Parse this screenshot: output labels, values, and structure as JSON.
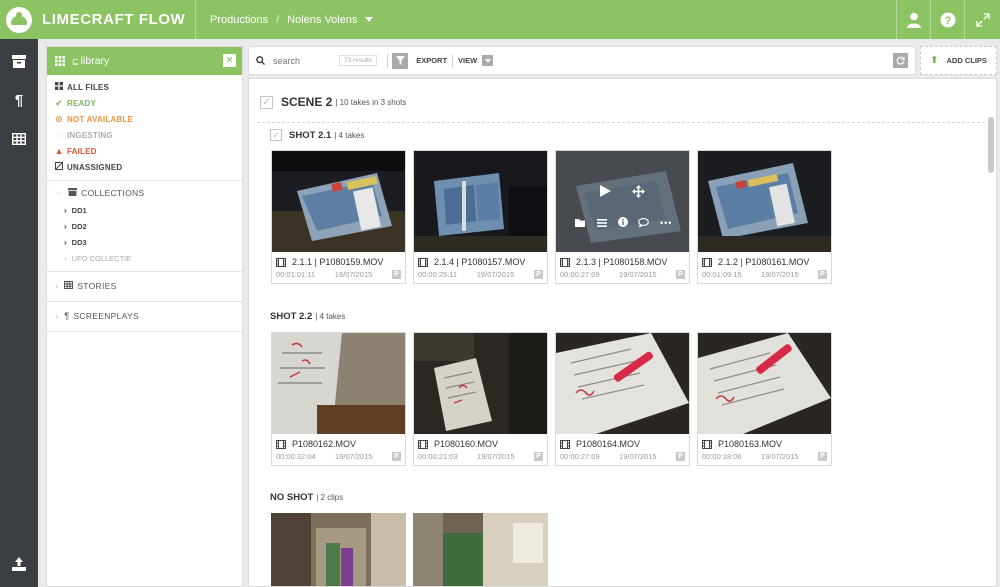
{
  "app": {
    "name": "LIMECRAFT FLOW"
  },
  "breadcrumb": {
    "section": "Productions",
    "separator": "/",
    "project": "Nolens Volens"
  },
  "library": {
    "title": "library",
    "close": "×",
    "filters": [
      {
        "label": "ALL FILES",
        "icon": "all-files-icon",
        "color": "dark"
      },
      {
        "label": "READY",
        "icon": "check-icon",
        "color": "green"
      },
      {
        "label": "NOT AVAILABLE",
        "icon": "block-icon",
        "color": "orange"
      },
      {
        "label": "INGESTING",
        "icon": "spinner-icon",
        "color": "grey"
      },
      {
        "label": "FAILED",
        "icon": "warning-icon",
        "color": "red"
      },
      {
        "label": "UNASSIGNED",
        "icon": "unassigned-icon",
        "color": "dark"
      }
    ],
    "collections": {
      "label": "COLLECTIONS",
      "items": [
        "DD1",
        "DD2",
        "DD3",
        "UFO COLLECTIE"
      ]
    },
    "stories": {
      "label": "STORIES"
    },
    "screenplays": {
      "label": "SCREENPLAYS"
    }
  },
  "toolbar": {
    "search_placeholder": "search",
    "results": "73 results",
    "export_label": "EXPORT",
    "view_label": "VIEW",
    "add_clips_label": "ADD CLIPS"
  },
  "scene": {
    "title": "SCENE 2",
    "meta": "| 10 takes in 3 shots"
  },
  "shots": [
    {
      "title": "SHOT 2.1",
      "meta": "| 4 takes",
      "clips": [
        {
          "name": "2.1.1 | P1080159.MOV",
          "duration": "00:01:01:11",
          "date": "19/07/2015"
        },
        {
          "name": "2.1.4 | P1080157.MOV",
          "duration": "00:00:25:11",
          "date": "19/07/2015"
        },
        {
          "name": "2.1.3 | P1080158.MOV",
          "duration": "00:00:27:09",
          "date": "19/07/2015"
        },
        {
          "name": "2.1.2 | P1080161.MOV",
          "duration": "00:01:09:15",
          "date": "19/07/2015"
        }
      ]
    },
    {
      "title": "SHOT 2.2",
      "meta": "| 4 takes",
      "clips": [
        {
          "name": "P1080162.MOV",
          "duration": "00:00:32:04",
          "date": "19/07/2015"
        },
        {
          "name": "P1080160.MOV",
          "duration": "00:00:21:03",
          "date": "19/07/2015"
        },
        {
          "name": "P1080164.MOV",
          "duration": "00:00:27:09",
          "date": "19/07/2015"
        },
        {
          "name": "P1080163.MOV",
          "duration": "00:00:18:06",
          "date": "19/07/2015"
        }
      ]
    },
    {
      "title": "NO SHOT",
      "meta": "| 2 clips",
      "clips": []
    }
  ],
  "badge_letter": "P",
  "colors": {
    "brand": "#8cc363",
    "rail": "#3b3f44",
    "ready": "#7ab55a",
    "not_available": "#f0913a",
    "failed": "#e0572f"
  }
}
